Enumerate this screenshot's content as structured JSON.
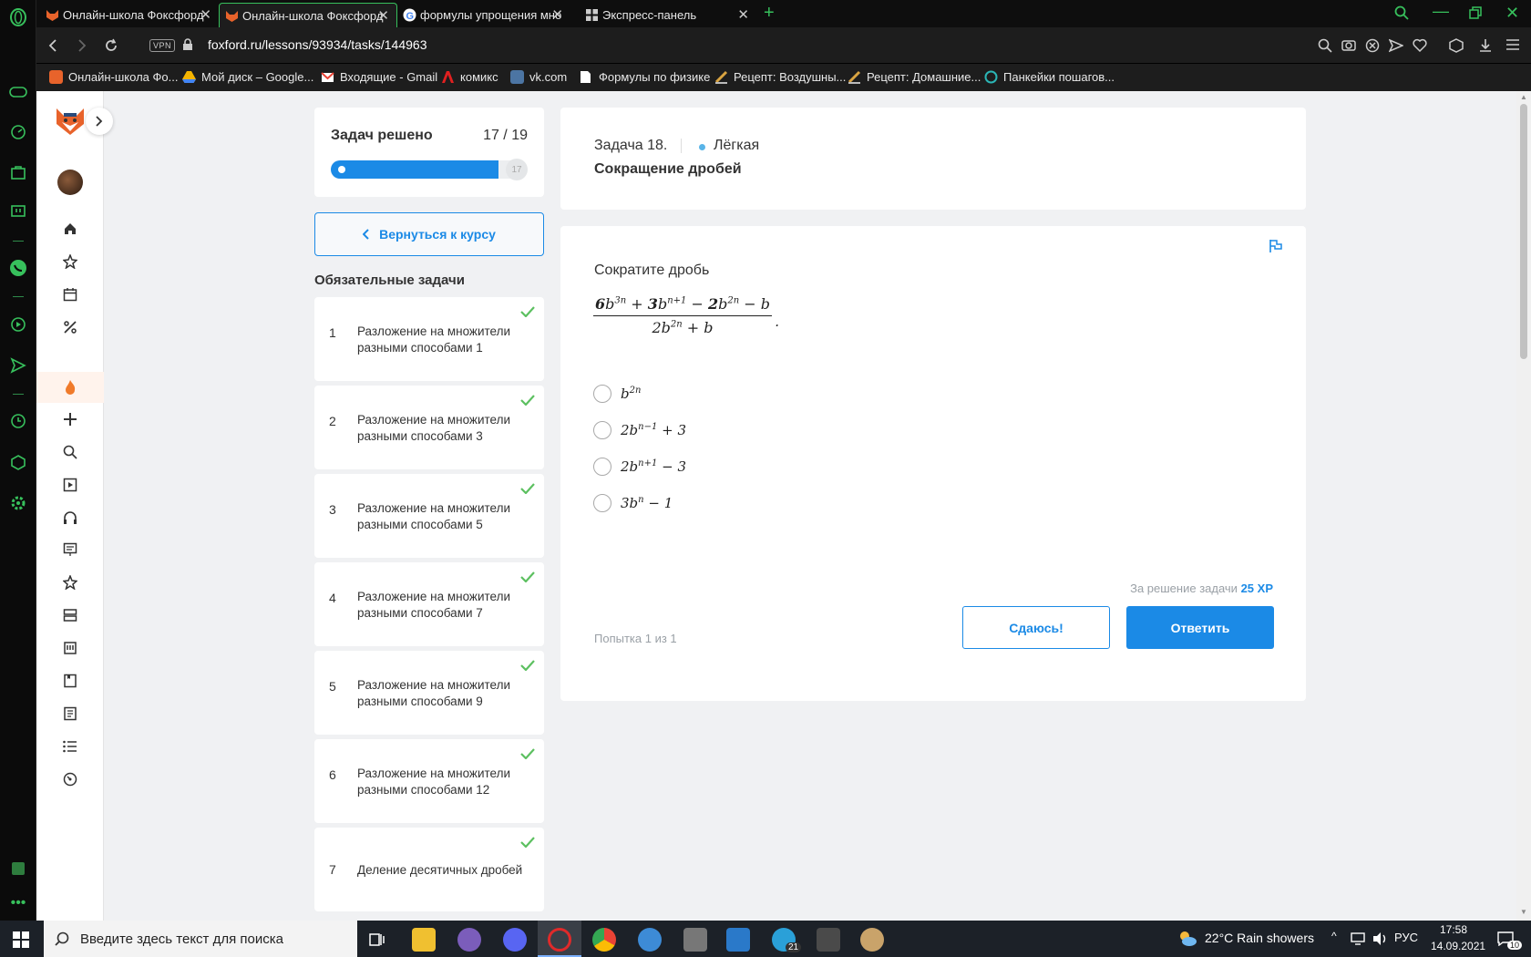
{
  "browser": {
    "tabs": [
      {
        "title": "Онлайн-школа Фоксфорд",
        "active": false
      },
      {
        "title": "Онлайн-школа Фоксфорд",
        "active": true
      },
      {
        "title": "формулы упрощения мно",
        "active": false
      },
      {
        "title": "Экспресс-панель",
        "active": false
      }
    ],
    "vpn_label": "VPN",
    "url": "foxford.ru/lessons/93934/tasks/144963",
    "bookmarks": [
      "Онлайн-школа Фо...",
      "Мой диск – Google...",
      "Входящие - Gmail",
      "комикс",
      "vk.com",
      "Формулы по физике",
      "Рецепт: Воздушны...",
      "Рецепт: Домашние...",
      "Панкейки пошагов..."
    ]
  },
  "progress": {
    "label": "Задач решено",
    "count": "17 / 19",
    "badge": "17",
    "solved": 17,
    "total": 19
  },
  "back_button": "Вернуться к курсу",
  "required_tasks": {
    "heading": "Обязательные задачи",
    "items": [
      {
        "num": "1",
        "title": "Разложение на множители разными способами 1"
      },
      {
        "num": "2",
        "title": "Разложение на множители разными способами 3"
      },
      {
        "num": "3",
        "title": "Разложение на множители разными способами 5"
      },
      {
        "num": "4",
        "title": "Разложение на множители разными способами 7"
      },
      {
        "num": "5",
        "title": "Разложение на множители разными способами 9"
      },
      {
        "num": "6",
        "title": "Разложение на множители разными способами 12"
      },
      {
        "num": "7",
        "title": "Деление десятичных дробей"
      }
    ]
  },
  "task": {
    "number": "Задача 18.",
    "difficulty": "Лёгкая",
    "title": "Сокращение дробей",
    "prompt": "Сократите дробь",
    "fraction_num": "6b^{3n} + 3b^{n+1} − 2b^{2n} − b",
    "fraction_den": "2b^{2n} + b",
    "options": [
      "b^{2n}",
      "2b^{n−1} + 3",
      "2b^{n+1} − 3",
      "3b^{n} − 1"
    ],
    "reward_label": "За решение задачи",
    "reward_xp": "25 XP",
    "attempt": "Попытка 1 из 1",
    "give_up": "Сдаюсь!",
    "answer": "Ответить"
  },
  "taskbar": {
    "search_placeholder": "Введите здесь текст для поиска",
    "telegram_badge": "21",
    "weather": "22°C  Rain showers",
    "lang": "РУС",
    "time": "17:58",
    "date": "14.09.2021",
    "notifications": "10"
  },
  "colors": {
    "accent_blue": "#1b8ae6",
    "opera_green": "#37c05c",
    "check_green": "#5cc060"
  }
}
